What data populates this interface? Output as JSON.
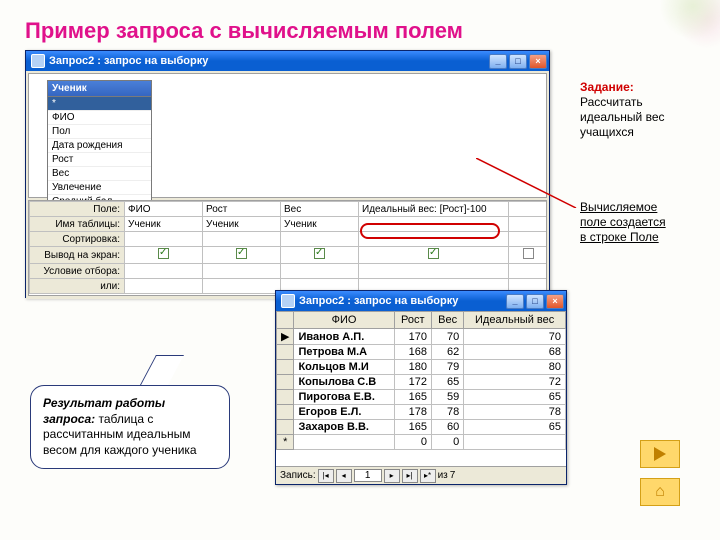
{
  "heading": "Пример  запроса с вычисляемым полем",
  "task": {
    "label": "Задание:",
    "text": "Рассчитать идеальный вес учащихся"
  },
  "calc_note": {
    "line1": "Вычисляемое",
    "line2": "поле создается",
    "line3": "в строке Поле"
  },
  "design_window": {
    "title": "Запрос2 : запрос на выборку",
    "field_list": {
      "title": "Ученик",
      "items": [
        "*",
        "ФИО",
        "Пол",
        "Дата рождения",
        "Рост",
        "Вес",
        "Увлечение",
        "Средний бал"
      ]
    },
    "row_labels": [
      "Поле:",
      "Имя таблицы:",
      "Сортировка:",
      "Вывод на экран:",
      "Условие отбора:",
      "или:"
    ],
    "columns": [
      {
        "field": "ФИО",
        "table": "Ученик",
        "show": true
      },
      {
        "field": "Рост",
        "table": "Ученик",
        "show": true
      },
      {
        "field": "Вес",
        "table": "Ученик",
        "show": true
      },
      {
        "field": "Идеальный вес: [Рост]-100",
        "table": "",
        "show": true
      },
      {
        "field": "",
        "table": "",
        "show": false
      }
    ]
  },
  "result_window": {
    "title": "Запрос2 : запрос на выборку",
    "columns": [
      "ФИО",
      "Рост",
      "Вес",
      "Идеальный вес"
    ],
    "rows": [
      {
        "fio": "Иванов А.П.",
        "rost": 170,
        "ves": 70,
        "ideal": 70
      },
      {
        "fio": "Петрова М.А",
        "rost": 168,
        "ves": 62,
        "ideal": 68
      },
      {
        "fio": "Кольцов М.И",
        "rost": 180,
        "ves": 79,
        "ideal": 80
      },
      {
        "fio": "Копылова С.В",
        "rost": 172,
        "ves": 65,
        "ideal": 72
      },
      {
        "fio": "Пирогова Е.В.",
        "rost": 165,
        "ves": 59,
        "ideal": 65
      },
      {
        "fio": "Егоров Е.Л.",
        "rost": 178,
        "ves": 78,
        "ideal": 78
      },
      {
        "fio": "Захаров В.В.",
        "rost": 165,
        "ves": 60,
        "ideal": 65
      }
    ],
    "blank_row": {
      "fio": "",
      "rost": 0,
      "ves": 0
    },
    "nav": {
      "label": "Запись:",
      "current": "1",
      "total_prefix": "из",
      "total": "7"
    }
  },
  "bubble": {
    "lead": "Результат работы запроса:",
    "rest": " таблица с рассчитанным идеальным весом для каждого ученика"
  }
}
